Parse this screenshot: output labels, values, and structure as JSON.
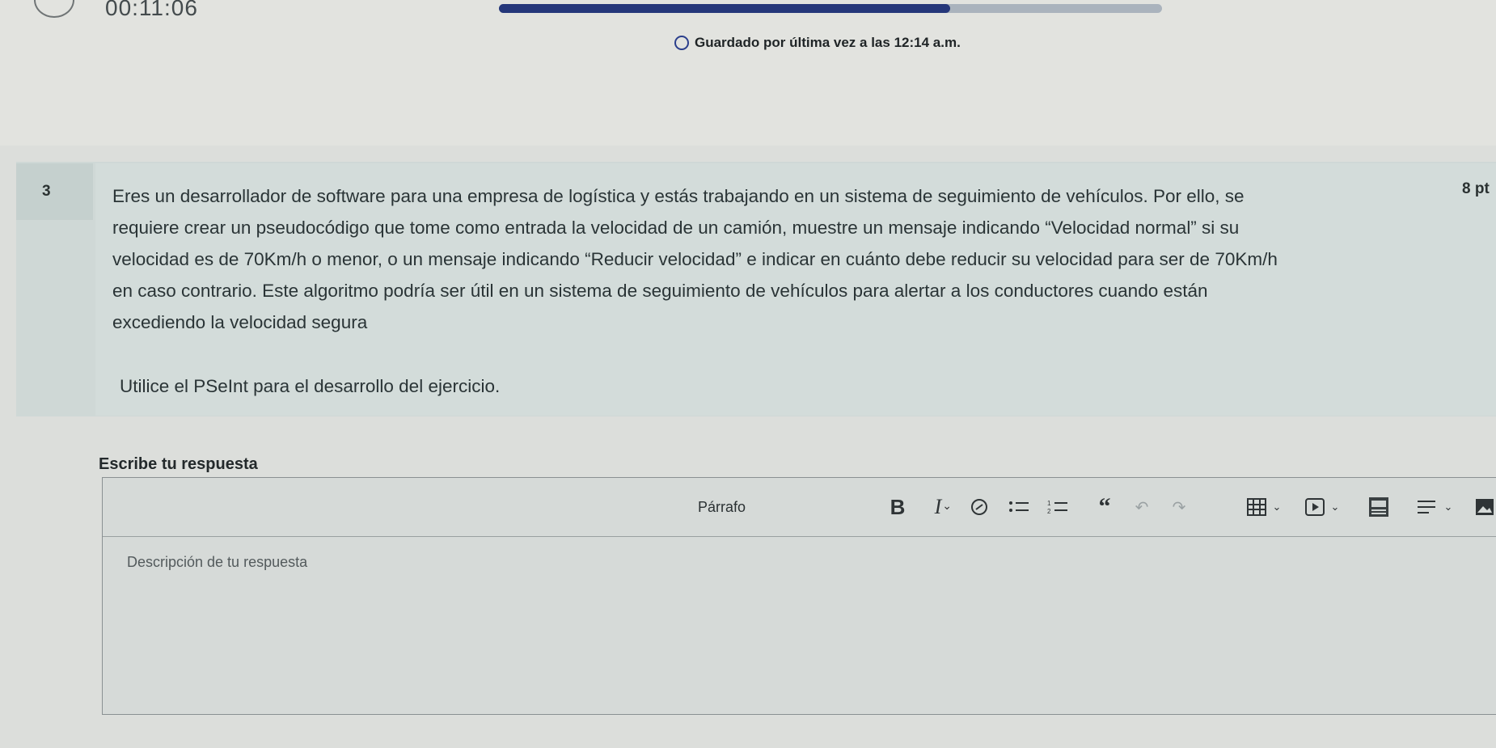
{
  "header": {
    "timer": "00:11:06",
    "progress_fraction": 0.68,
    "saved_text": "Guardado por última vez a las 12:14 a.m."
  },
  "question": {
    "number": "3",
    "points": "8 pt",
    "text": "Eres un desarrollador de software para una empresa de logística y estás trabajando en un sistema de seguimiento de vehículos. Por ello, se requiere crear un pseudocódigo que tome como entrada la velocidad de un camión, muestre un mensaje indicando “Velocidad normal” si su velocidad es de 70Km/h o menor, o un mensaje indicando “Reducir velocidad” e indicar en cuánto debe reducir su velocidad para ser de 70Km/h en caso contrario. Este algoritmo podría ser útil en un sistema de seguimiento de vehículos para alertar a los conductores cuando están excediendo la velocidad segura",
    "instruction": "Utilice el PSeInt para el desarrollo del ejercicio."
  },
  "answer": {
    "label": "Escribe tu respuesta",
    "placeholder": "Descripción de tu respuesta",
    "toolbar": {
      "paragraph_style": "Párrafo",
      "bold": "B",
      "italic": "I"
    }
  },
  "colors": {
    "progress_fill": "#25377a",
    "progress_track": "#aab3bd",
    "saved_icon": "#2b3f8c"
  },
  "icons": [
    "timer-icon",
    "saved-status-icon",
    "chevron-down-icon",
    "link-icon",
    "bullet-list-icon",
    "numbered-list-icon",
    "blockquote-icon",
    "undo-icon",
    "redo-icon",
    "table-icon",
    "media-icon",
    "image-icon",
    "align-icon"
  ]
}
